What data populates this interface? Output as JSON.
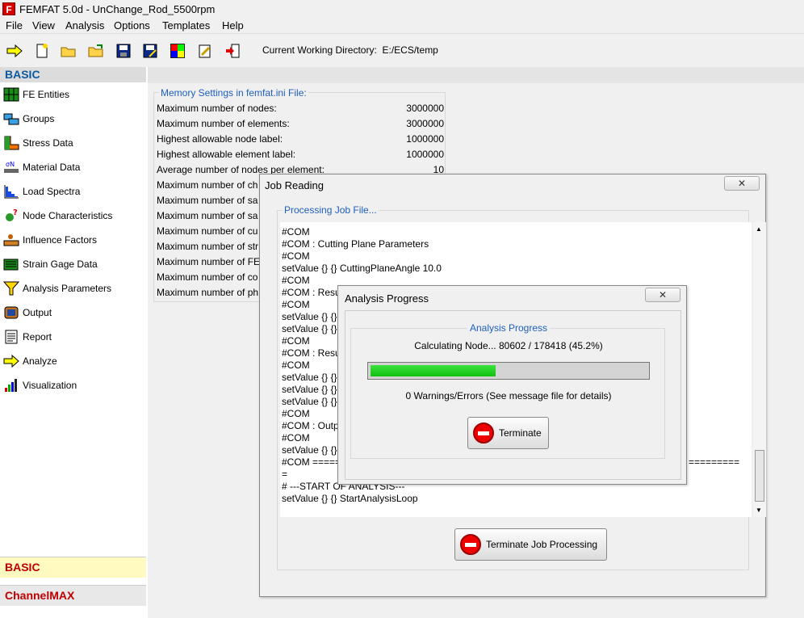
{
  "window": {
    "title": "FEMFAT 5.0d - UnChange_Rod_5500rpm",
    "logo": "F"
  },
  "menu": [
    "File",
    "View",
    "Analysis",
    "Options",
    "Templates",
    "Help"
  ],
  "toolbar": {
    "cwd_label": "Current Working Directory:",
    "cwd_value": "E:/ECS/temp"
  },
  "sidebar": {
    "header": "BASIC",
    "items": [
      "FE Entities",
      "Groups",
      "Stress Data",
      "Material Data",
      "Load Spectra",
      "Node Characteristics",
      "Influence Factors",
      "Strain Gage Data",
      "Analysis Parameters",
      "Output",
      "Report",
      "Analyze",
      "Visualization"
    ],
    "footer_active": "BASIC",
    "footer_other": "ChannelMAX"
  },
  "memory": {
    "title": "Memory Settings in femfat.ini File:",
    "rows": [
      {
        "label": "Maximum number of nodes:",
        "value": "3000000"
      },
      {
        "label": "Maximum number of elements:",
        "value": "3000000"
      },
      {
        "label": "Highest allowable node label:",
        "value": "1000000"
      },
      {
        "label": "Highest allowable element label:",
        "value": "1000000"
      },
      {
        "label": "Average number of nodes per element:",
        "value": "10"
      },
      {
        "label": "Maximum number of ch",
        "value": ""
      },
      {
        "label": "Maximum number of sa",
        "value": ""
      },
      {
        "label": "Maximum number of sa",
        "value": ""
      },
      {
        "label": "Maximum number of cu",
        "value": ""
      },
      {
        "label": "Maximum number of str",
        "value": ""
      },
      {
        "label": "Maximum number of FE",
        "value": ""
      },
      {
        "label": "Maximum number of co",
        "value": ""
      },
      {
        "label": "Maximum number of ph",
        "value": ""
      }
    ]
  },
  "job_dialog": {
    "title": "Job Reading",
    "close": "✕",
    "group_title": "Processing Job File...",
    "lines": [
      "#COM",
      "#COM : Cutting Plane Parameters",
      "#COM",
      "setValue {} {} CuttingPlaneAngle 10.0",
      "#COM",
      "#COM : Resu",
      "#COM",
      "setValue {} {}",
      "setValue {} {}",
      "#COM",
      "#COM : Resu",
      "#COM",
      "setValue {} {}",
      "setValue {} {}",
      "setValue {} {}",
      "#COM",
      "#COM : Outpu",
      "#COM",
      "setValue {} {}",
      "#COM ======",
      "=",
      "# ---START OF ANALYSIS---",
      "setValue {} {} StartAnalysisLoop"
    ],
    "overflow_text": "=========",
    "terminate_label": "Terminate Job Processing"
  },
  "progress_dialog": {
    "title": "Analysis Progress",
    "close": "✕",
    "group_title": "Analysis Progress",
    "status": "Calculating Node... 80602 / 178418 (45.2%)",
    "progress": 0.452,
    "warnings": "0 Warnings/Errors (See message file for details)",
    "terminate_label": "Terminate"
  }
}
